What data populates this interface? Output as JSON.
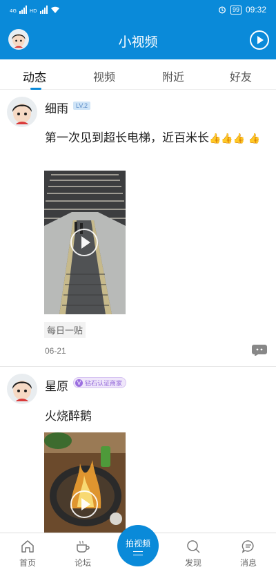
{
  "status_bar": {
    "network_left": "4G",
    "network_right": "HD",
    "battery": "99",
    "time": "09:32"
  },
  "header": {
    "title": "小视频"
  },
  "tabs": [
    {
      "label": "动态"
    },
    {
      "label": "视频"
    },
    {
      "label": "附近"
    },
    {
      "label": "好友"
    }
  ],
  "posts": [
    {
      "username": "细雨",
      "badge": "LV.2",
      "text_main": "第一次见到超长电梯，近百米长",
      "tag": "每日一贴",
      "date": "06-21"
    },
    {
      "username": "星原",
      "badge": "钻石认证商家",
      "badge_mark": "V",
      "text_main": "火烧醉鹅"
    }
  ],
  "bottom_nav": {
    "home": "首页",
    "forum": "论坛",
    "shoot": "拍视频",
    "discover": "发现",
    "messages": "消息"
  },
  "colors": {
    "accent": "#0a8ad9"
  }
}
